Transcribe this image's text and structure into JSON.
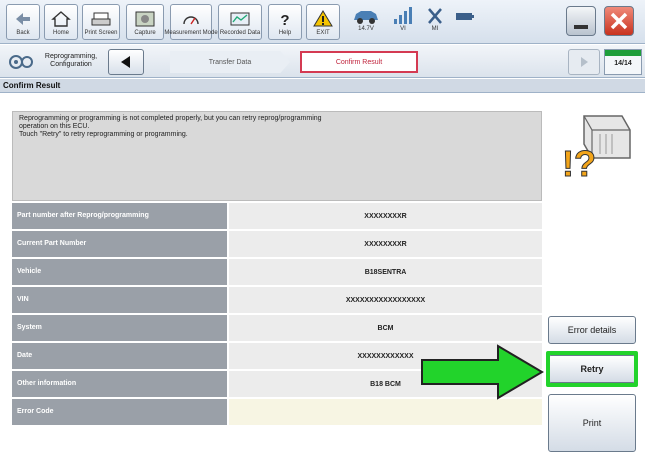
{
  "toolbar": {
    "buttons": [
      {
        "label": "Back",
        "icon": "back-arrow-icon"
      },
      {
        "label": "Home",
        "icon": "home-icon"
      },
      {
        "label": "Print Screen",
        "icon": "print-screen-icon"
      },
      {
        "label": "Capture",
        "icon": "capture-icon"
      },
      {
        "label": "Measurement Mode",
        "icon": "measurement-icon"
      },
      {
        "label": "Recorded Data",
        "icon": "recorded-data-icon"
      },
      {
        "label": "Help",
        "icon": "help-icon"
      },
      {
        "label": "EXIT",
        "icon": "exit-icon"
      }
    ],
    "voltage": "14.7V",
    "vi_label": "VI",
    "mi_label": "MI"
  },
  "stepbar": {
    "step_label": "Reprogramming, Configuration",
    "crumbs": [
      "Transfer Data",
      "Confirm Result"
    ],
    "page": "14/14",
    "progress": 1.0
  },
  "section_title": "Confirm Result",
  "message": {
    "line1": "Reprogramming or programming is not completed properly, but you can retry reprog/programming",
    "line2": "operation on this ECU.",
    "line3": "Touch \"Retry\" to retry reprogramming or programming."
  },
  "table": [
    {
      "label": "Part number after Reprog/programming",
      "value": "XXXXXXXXR"
    },
    {
      "label": "Current Part Number",
      "value": "XXXXXXXXR"
    },
    {
      "label": "Vehicle",
      "value": "B18SENTRA"
    },
    {
      "label": "VIN",
      "value": "XXXXXXXXXXXXXXXXX"
    },
    {
      "label": "System",
      "value": "BCM"
    },
    {
      "label": "Date",
      "value": "XXXXXXXXXXXX"
    },
    {
      "label": "Other information",
      "value": "B18 BCM"
    },
    {
      "label": "Error Code",
      "value": ""
    }
  ],
  "buttons": {
    "error_details": "Error details",
    "retry": "Retry",
    "print": "Print"
  },
  "colors": {
    "highlight_green": "#22d32b",
    "active_crumb": "#d43a52",
    "progress_green": "#1f9e3a"
  }
}
